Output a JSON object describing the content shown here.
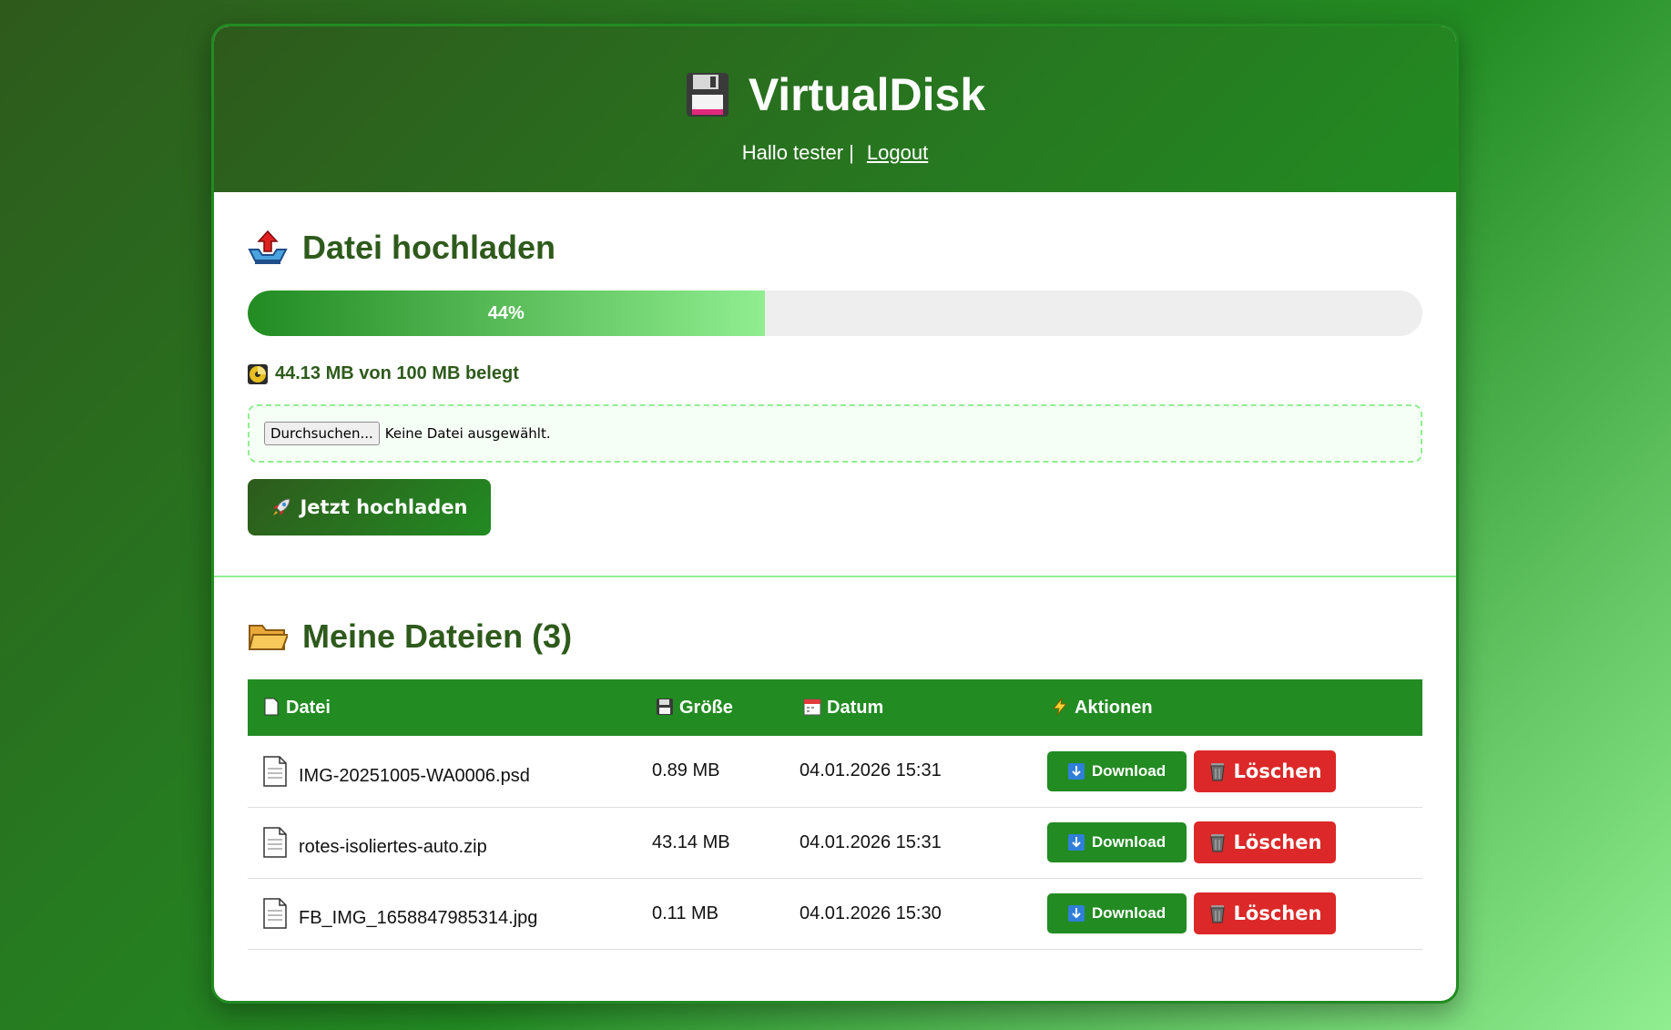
{
  "header": {
    "app_icon": "floppy-disk-icon",
    "title": "VirtualDisk",
    "greeting": "Hallo tester |",
    "logout_label": "Logout"
  },
  "upload": {
    "heading_icon": "outbox-tray-icon",
    "heading": "Datei hochladen",
    "progress_percent": 44,
    "progress_label": "44%",
    "usage_icon": "disc-icon",
    "usage_text": "44.13 MB von 100 MB belegt",
    "browse_label": "Durchsuchen...",
    "no_file_text": "Keine Datei ausgewählt.",
    "submit_icon": "rocket-icon",
    "submit_label": "Jetzt hochladen"
  },
  "files": {
    "heading_icon": "folder-icon",
    "heading": "Meine Dateien (3)",
    "columns": [
      {
        "icon": "page-icon",
        "label": "Datei"
      },
      {
        "icon": "floppy-disk-icon",
        "label": "Größe"
      },
      {
        "icon": "calendar-icon",
        "label": "Datum"
      },
      {
        "icon": "lightning-icon",
        "label": "Aktionen"
      }
    ],
    "rows": [
      {
        "name": "IMG-20251005-WA0006.psd",
        "size": "0.89 MB",
        "date": "04.01.2026 15:31",
        "download_label": "Download",
        "delete_label": "Löschen"
      },
      {
        "name": "rotes-isoliertes-auto.zip",
        "size": "43.14 MB",
        "date": "04.01.2026 15:31",
        "download_label": "Download",
        "delete_label": "Löschen"
      },
      {
        "name": "FB_IMG_1658847985314.jpg",
        "size": "0.11 MB",
        "date": "04.01.2026 15:30",
        "download_label": "Download",
        "delete_label": "Löschen"
      }
    ]
  },
  "colors": {
    "primary": "#228b22",
    "dark": "#2e5a1c",
    "light": "#90ee90",
    "danger": "#dc2828"
  }
}
